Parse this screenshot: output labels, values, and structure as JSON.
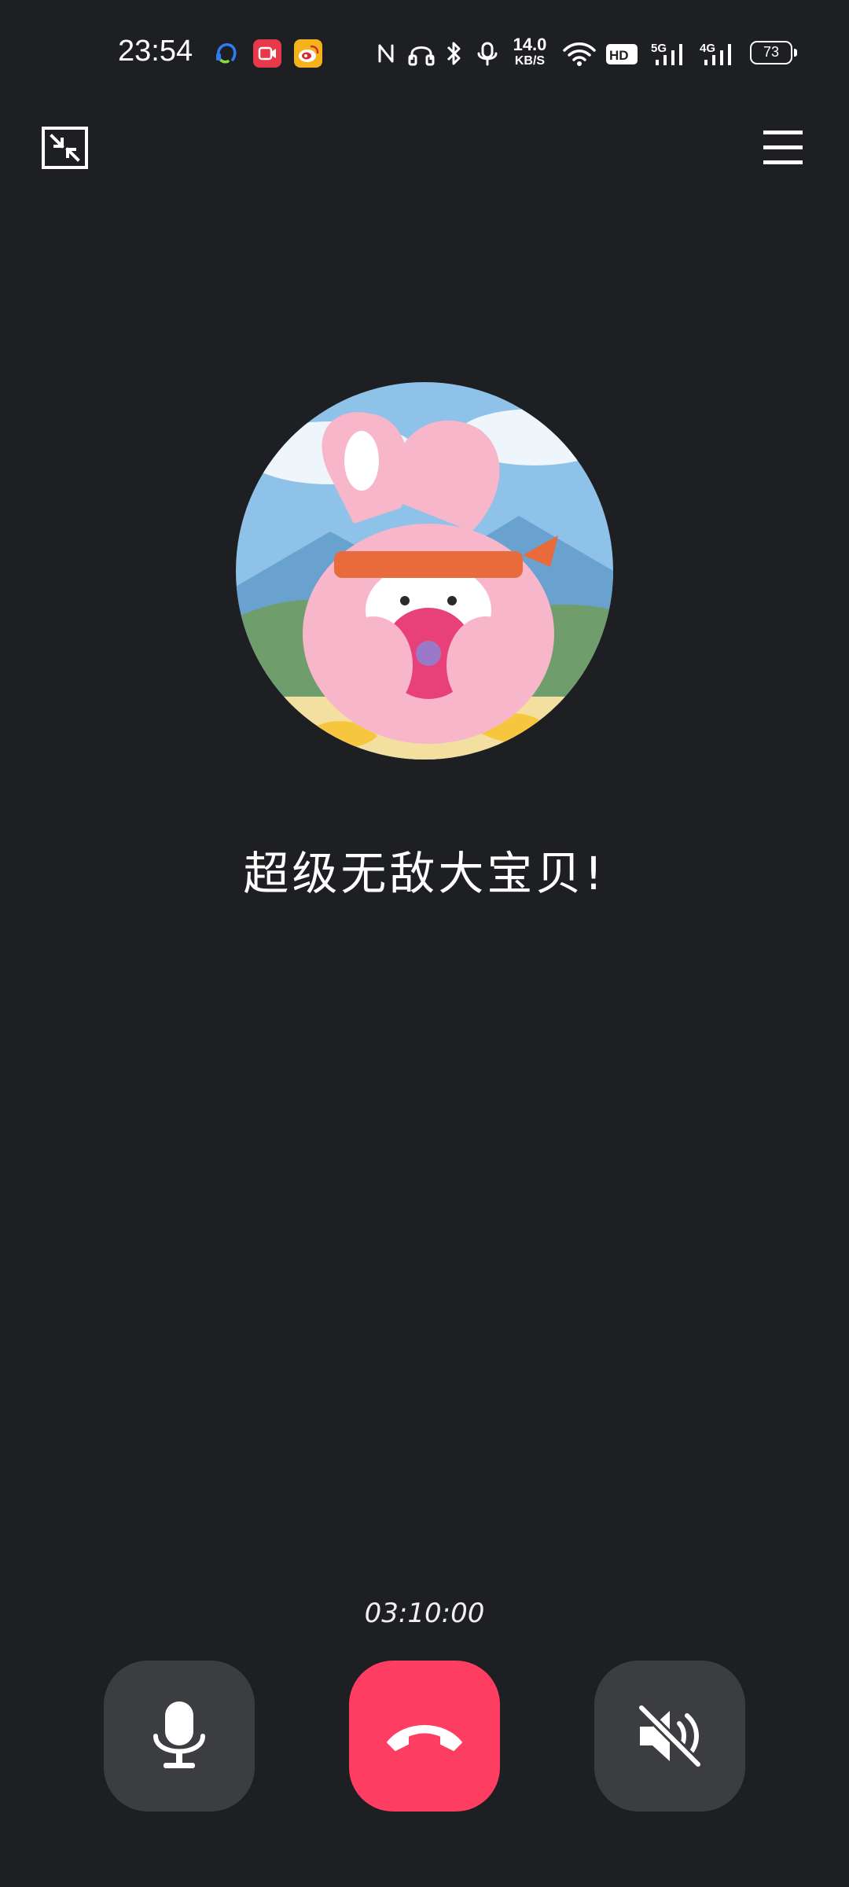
{
  "status_bar": {
    "time": "23:54",
    "net_speed_value": "14.0",
    "net_speed_unit": "KB/S",
    "battery_level": "73",
    "apps": [
      "headset-app-icon",
      "video-app-icon",
      "weibo-app-icon"
    ],
    "system_icons": [
      "nfc-icon",
      "headphones-icon",
      "bluetooth-icon",
      "mic-icon",
      "wifi-icon",
      "hd-voice-icon",
      "signal-5g-icon",
      "signal-4g-icon",
      "battery-icon"
    ],
    "network_labels": [
      "HD",
      "5G",
      "4G"
    ]
  },
  "toolbar": {
    "minimize_icon": "minimize-window-icon",
    "menu_icon": "menu-icon"
  },
  "call": {
    "contact_name": "超级无敌大宝贝!",
    "timer": "03:10:00",
    "avatar": "cartoon-pink-bunny"
  },
  "controls": {
    "mute_icon": "microphone-icon",
    "hangup_icon": "hang-up-phone-icon",
    "speaker_icon": "speaker-muted-icon"
  },
  "colors": {
    "background": "#1e1f22",
    "control_gray": "#3c3d40",
    "hangup_red": "#fe3d63"
  }
}
